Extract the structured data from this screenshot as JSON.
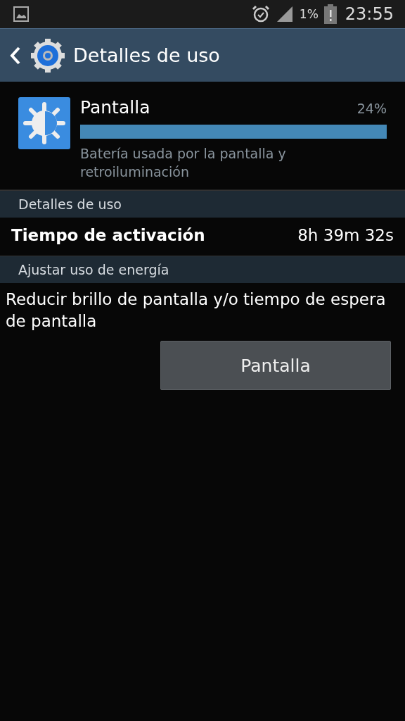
{
  "status_bar": {
    "battery_text": "1%",
    "time": "23:55"
  },
  "action_bar": {
    "title": "Detalles de uso"
  },
  "app": {
    "name": "Pantalla",
    "percent": "24%",
    "level": 1,
    "description": "Batería usada por la pantalla y retroiluminación"
  },
  "sections": [
    {
      "header": "Detalles de uso",
      "rows": [
        {
          "label": "Tiempo de activación",
          "value": "8h 39m 32s"
        }
      ]
    },
    {
      "header": "Ajustar uso de energía",
      "text": "Reducir brillo de pantalla y/o tiempo de espera de pantalla",
      "button": "Pantalla"
    }
  ]
}
